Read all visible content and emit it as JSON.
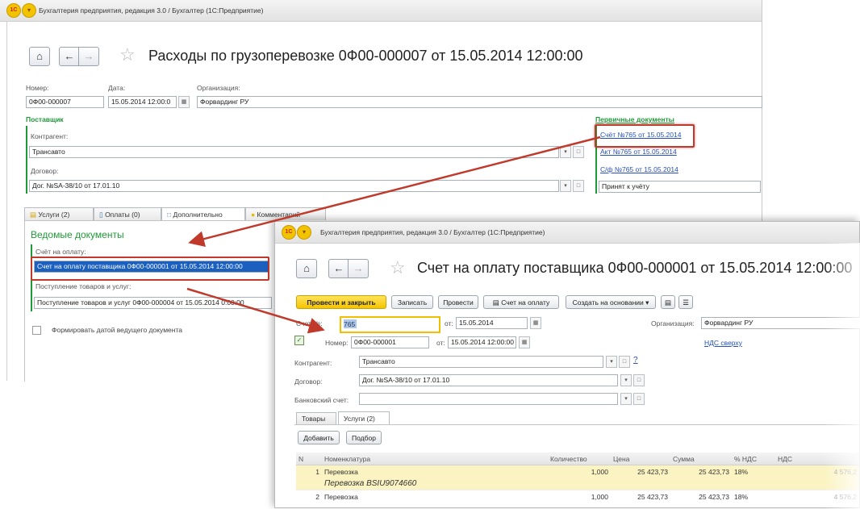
{
  "bg_window": {
    "title": "Бухгалтерия предприятия, редакция 3.0 / Бухгалтер  (1С:Предприятие)",
    "logo_text": "1C",
    "doc_title": "Расходы по грузоперевозке 0Ф00-000007 от 15.05.2014 12:00:00",
    "number_label": "Номер:",
    "number_value": "0Ф00-000007",
    "date_label": "Дата:",
    "date_value": "15.05.2014 12:00:0",
    "org_label": "Организация:",
    "org_value": "Форвардинг РУ",
    "supplier_header": "Поставщик",
    "counterparty_label": "Контрагент:",
    "counterparty_value": "Трансавто",
    "contract_label": "Договор:",
    "contract_value": "Дог. №SA-38/10 от 17.01.10",
    "primary_docs_header": "Первичные документы",
    "primary_docs": [
      "Счёт №765 от 15.05.2014",
      "Акт №765 от 15.05.2014",
      "С/ф №765 от 15.05.2014"
    ],
    "status_value": "Принят к учёту",
    "tabs": [
      "Услуги (2)",
      "Оплаты (0)",
      "Дополнительно",
      "Комментарий"
    ],
    "section_title": "Ведомые документы",
    "invoice_label": "Счёт на оплату:",
    "invoice_value": "Счет на оплату поставщика 0Ф00-000001 от 15.05.2014 12:00:00",
    "receipt_label": "Поступление товаров и услуг:",
    "receipt_value": "Поступление товаров и услуг 0Ф00-000004 от 15.05.2014 0:00:00",
    "checkbox_label": "Формировать датой ведущего документа"
  },
  "fg_window": {
    "title": "Бухгалтерия предприятия, редакция 3.0 / Бухгалтер  (1С:Предприятие)",
    "logo_text": "1C",
    "doc_title": "Счет на оплату поставщика 0Ф00-000001 от 15.05.2014 12:00:00",
    "toolbar": {
      "post_close": "Провести и закрыть",
      "save": "Записать",
      "post": "Провести",
      "invoice_print": "Счет на оплату",
      "create_based": "Создать на основании"
    },
    "invoice_no_label": "Счет №:",
    "invoice_no_value": "765",
    "from_label": "от:",
    "from_value": "15.05.2014",
    "org_label": "Организация:",
    "org_value": "Форвардинг РУ",
    "number_label": "Номер:",
    "number_value": "0Ф00-000001",
    "number_date_label": "от:",
    "number_date_value": "15.05.2014 12:00:00",
    "vat_link": "НДС сверху",
    "counterparty_label": "Контрагент:",
    "counterparty_value": "Трансавто",
    "help": "?",
    "contract_label": "Договор:",
    "contract_value": "Дог. №SA-38/10 от 17.01.10",
    "bank_label": "Банковский счет:",
    "bank_value": "",
    "tabs": [
      "Товары",
      "Услуги (2)"
    ],
    "add_button": "Добавить",
    "pick_button": "Подбор",
    "table_headers": [
      "N",
      "Номенклатура",
      "Количество",
      "Цена",
      "Сумма",
      "% НДС",
      "НДС"
    ],
    "rows": [
      {
        "n": "1",
        "name": "Перевозка",
        "sub": "Перевозка BSIU9074660",
        "qty": "1,000",
        "price": "25 423,73",
        "sum": "25 423,73",
        "vat_rate": "18%",
        "vat": "4 576,2"
      },
      {
        "n": "2",
        "name": "Перевозка",
        "sub": "",
        "qty": "1,000",
        "price": "25 423,73",
        "sum": "25 423,73",
        "vat_rate": "18%",
        "vat": "4 576,2"
      }
    ]
  },
  "colors": {
    "accent_green": "#1e9b36",
    "link_blue": "#2450b8",
    "highlight_red": "#c0392b",
    "primary_yellow": "#f5c400",
    "selection_blue": "#1b5fbf",
    "row_yellow": "#fbf3c1"
  }
}
